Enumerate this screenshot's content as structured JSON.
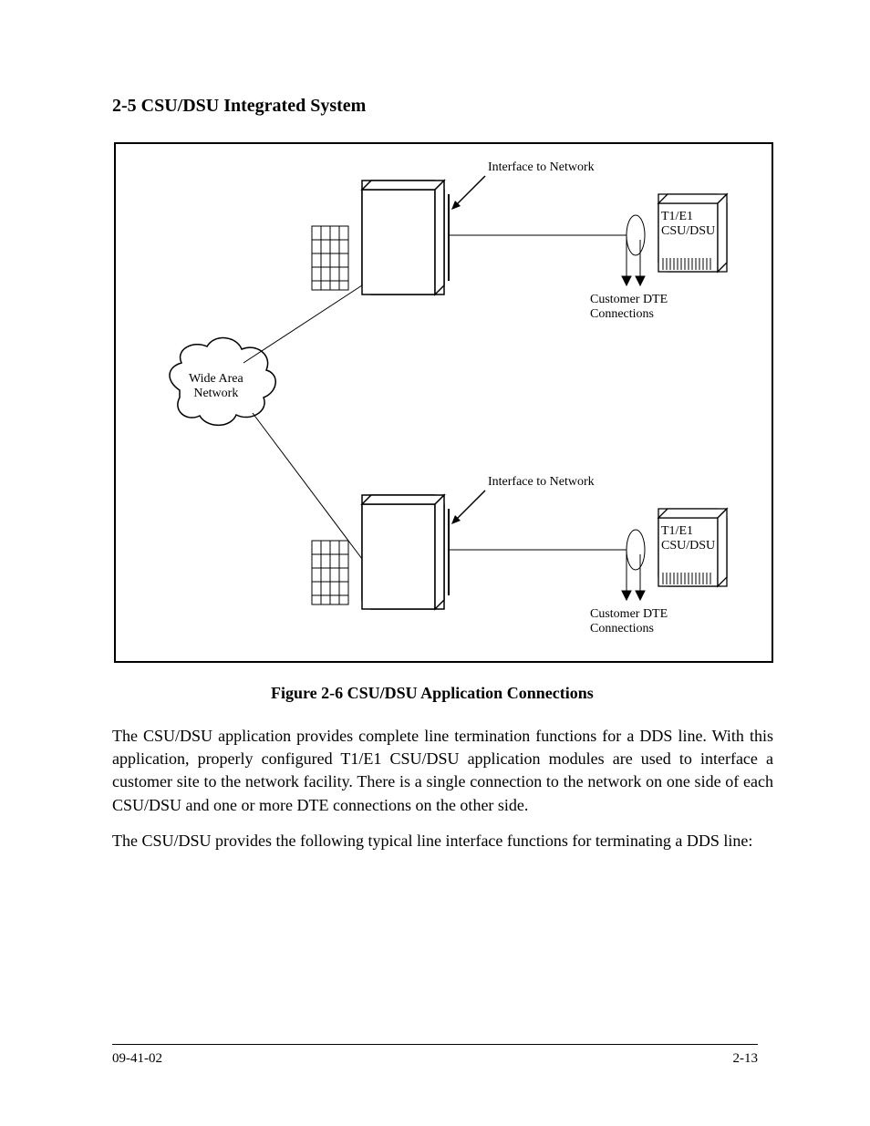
{
  "heading": "2-5 CSU/DSU Integrated System",
  "caption": "Figure 2-6 CSU/DSU Application Connections",
  "paragraphs": [
    "The CSU/DSU application provides complete line termination functions for a DDS line. With this application, properly configured T1/E1 CSU/DSU application modules are used to interface a customer site to the network facility. There is a single connection to the network on one side of each CSU/DSU and one or more DTE connections on the other side.",
    "The CSU/DSU provides the following typical line interface functions for terminating a DDS line:"
  ],
  "diagram": {
    "wan_label": "Wide Area\nNetwork",
    "network_label": "Interface to Network",
    "dte_label": "Customer DTE\nConnections",
    "tbox_label": "T1/E1\nCSU/DSU"
  },
  "footer": {
    "left": "09-41-02",
    "right": "2-13"
  }
}
